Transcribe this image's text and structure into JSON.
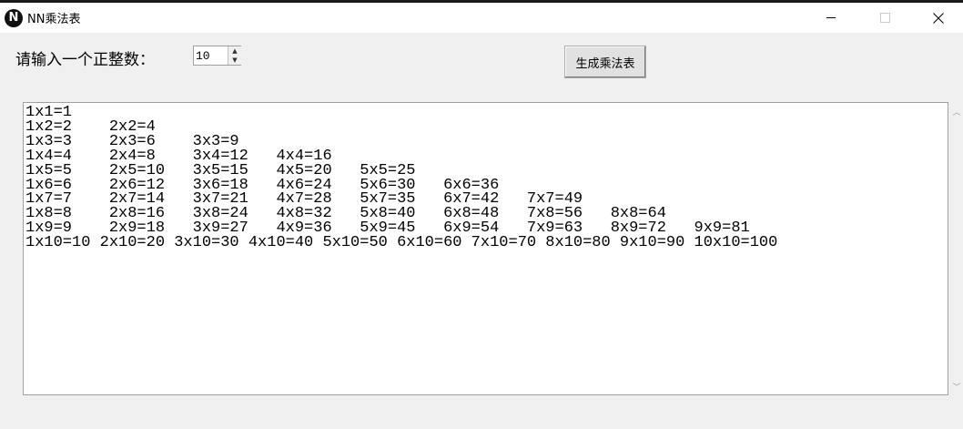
{
  "window": {
    "title": "NN乘法表",
    "icon_glyph": "N"
  },
  "form": {
    "prompt_label": "请输入一个正整数：",
    "number_value": "10",
    "generate_label": "生成乘法表"
  },
  "output": {
    "lines": [
      "1x1=1",
      "1x2=2    2x2=4",
      "1x3=3    2x3=6    3x3=9",
      "1x4=4    2x4=8    3x4=12   4x4=16",
      "1x5=5    2x5=10   3x5=15   4x5=20   5x5=25",
      "1x6=6    2x6=12   3x6=18   4x6=24   5x6=30   6x6=36",
      "1x7=7    2x7=14   3x7=21   4x7=28   5x7=35   6x7=42   7x7=49",
      "1x8=8    2x8=16   3x8=24   4x8=32   5x8=40   6x8=48   7x8=56   8x8=64",
      "1x9=9    2x9=18   3x9=27   4x9=36   5x9=45   6x9=54   7x9=63   8x9=72   9x9=81",
      "1x10=10 2x10=20 3x10=30 4x10=40 5x10=50 6x10=60 7x10=70 8x10=80 9x10=90 10x10=100"
    ]
  }
}
